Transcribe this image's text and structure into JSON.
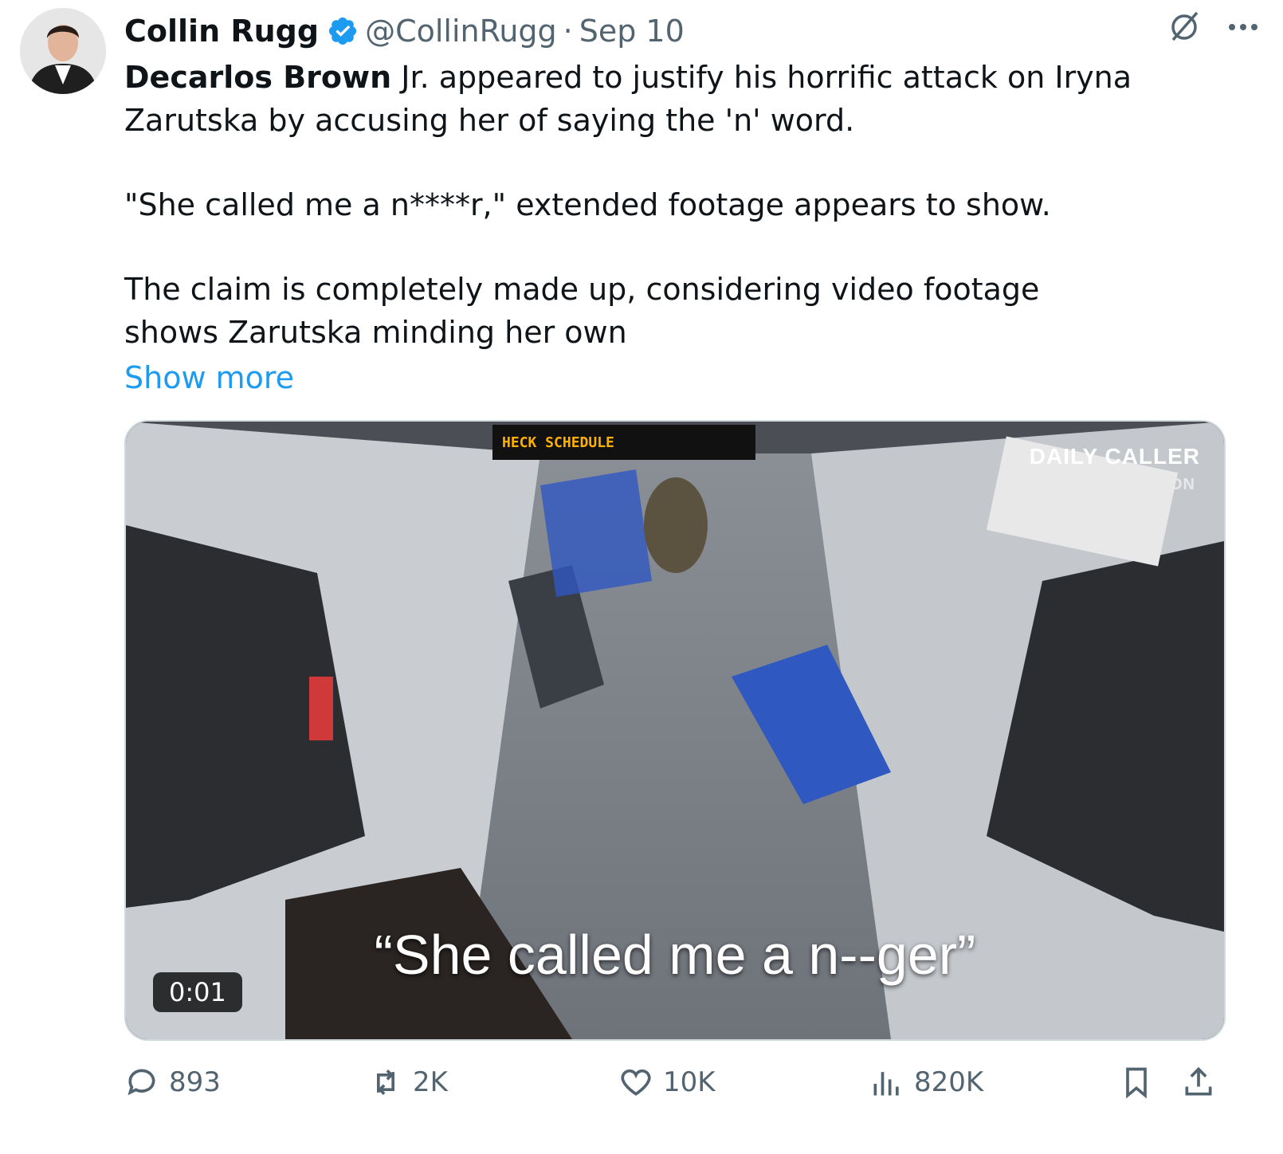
{
  "author": {
    "name": "Collin Rugg",
    "handle": "@CollinRugg",
    "separator": "·",
    "date": "Sep 10"
  },
  "tweet": {
    "p1_bold": "Decarlos Brown",
    "p1_rest": " Jr. appeared to justify his horrific attack on Iryna Zarutska by accusing her of saying the 'n' word.",
    "p2": "\"She called me a n****r,\" extended footage appears to show.",
    "p3": "The claim is completely made up, considering video footage shows Zarutska minding her own",
    "show_more": "Show more"
  },
  "media": {
    "duration": "0:01",
    "caption": "“She called me a n--ger”",
    "watermark_line1": "DAILY CALLER",
    "watermark_line2": "NEWS FOUNDATION",
    "sign_text": "HECK SCHEDULE"
  },
  "actions": {
    "replies": "893",
    "reposts": "2K",
    "likes": "10K",
    "views": "820K"
  },
  "colors": {
    "verified": "#1d9bf0",
    "link": "#1d9bf0",
    "muted": "#536471"
  }
}
